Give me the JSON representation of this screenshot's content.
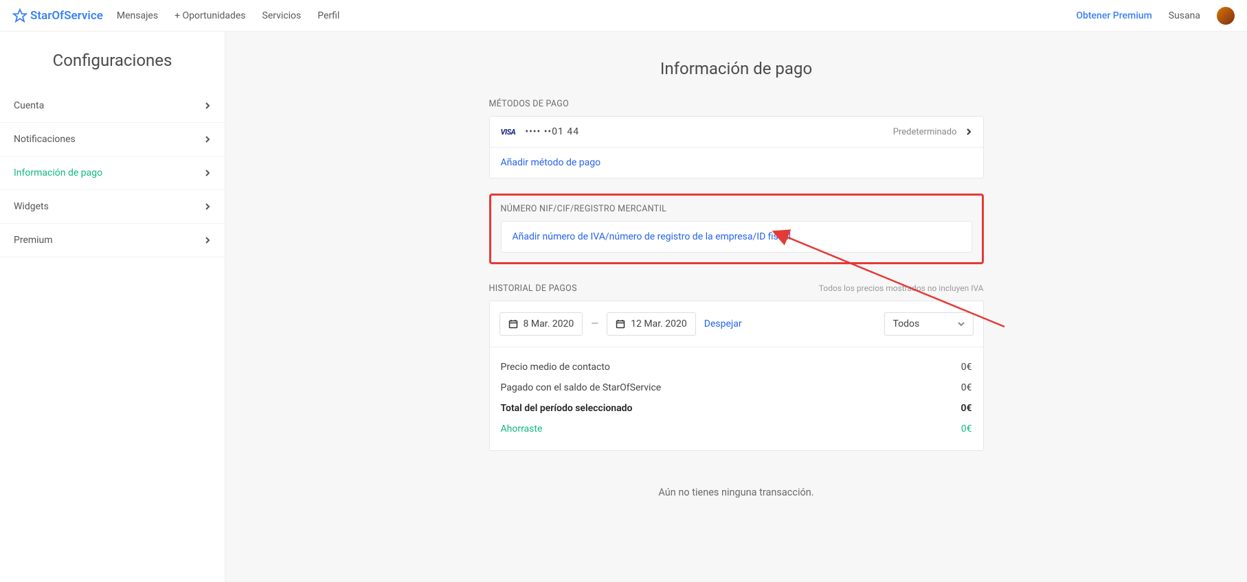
{
  "logo_text": "StarOfService",
  "nav": {
    "mensajes": "Mensajes",
    "oportunidades": "+ Oportunidades",
    "servicios": "Servicios",
    "perfil": "Perfil"
  },
  "top_right": {
    "premium": "Obtener Premium",
    "username": "Susana"
  },
  "sidebar": {
    "title": "Configuraciones",
    "items": [
      {
        "label": "Cuenta"
      },
      {
        "label": "Notificaciones"
      },
      {
        "label": "Información de pago"
      },
      {
        "label": "Widgets"
      },
      {
        "label": "Premium"
      }
    ]
  },
  "page_title": "Información de pago",
  "payment_methods": {
    "heading": "MÉTODOS DE PAGO",
    "card_brand": "VISA",
    "masked": "•••• ••01 44",
    "default_label": "Predeterminado",
    "add_link": "Añadir método de pago"
  },
  "vat": {
    "heading": "NÚMERO NIF/CIF/REGISTRO MERCANTIL",
    "add_link": "Añadir número de IVA/número de registro de la empresa/ID fiscal"
  },
  "history": {
    "heading": "HISTORIAL DE PAGOS",
    "note": "Todos los precios mostrados no incluyen IVA",
    "date_from": "8 Mar. 2020",
    "date_to": "12 Mar. 2020",
    "clear": "Despejar",
    "filter_all": "Todos",
    "rows": {
      "avg_label": "Precio medio de contacto",
      "avg_value": "0€",
      "paid_label": "Pagado con el saldo de StarOfService",
      "paid_value": "0€",
      "total_label": "Total del período seleccionado",
      "total_value": "0€",
      "saved_label": "Ahorraste",
      "saved_value": "0€"
    }
  },
  "no_tx": "Aún no tienes ninguna transacción."
}
